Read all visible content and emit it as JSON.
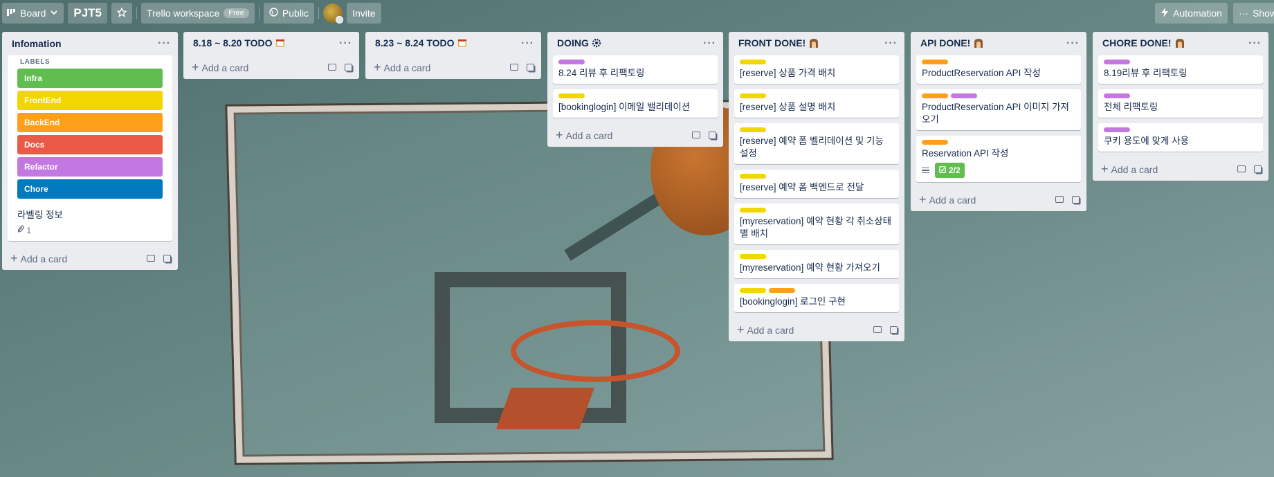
{
  "topbar": {
    "board_view": "Board",
    "board_title": "PJT5",
    "workspace": "Trello workspace",
    "workspace_badge": "Free",
    "visibility": "Public",
    "invite": "Invite",
    "automation": "Automation",
    "show_menu": "Show"
  },
  "lists": [
    {
      "title": "Infomation",
      "labels_heading": "LABELS",
      "labels": [
        {
          "name": "Infra",
          "color": "#61bd4f"
        },
        {
          "name": "FrontEnd",
          "color": "#f2d600"
        },
        {
          "name": "BackEnd",
          "color": "#ff9f1a"
        },
        {
          "name": "Docs",
          "color": "#eb5a46"
        },
        {
          "name": "Refactor",
          "color": "#c377e0"
        },
        {
          "name": "Chore",
          "color": "#0079bf"
        }
      ],
      "card_text": "라벨링 정보",
      "attachments": "1",
      "add_card": "Add a card"
    },
    {
      "title": "8.18 ~ 8.20 TODO",
      "add_card": "Add a card"
    },
    {
      "title": "8.23 ~ 8.24 TODO",
      "add_card": "Add a card"
    },
    {
      "title": "DOING",
      "cards": [
        {
          "text": "8.24 리뷰 후 리팩토링",
          "labels": [
            "purple"
          ]
        },
        {
          "text": "[bookinglogin] 이메일 밸리데이션",
          "labels": [
            "yellow"
          ]
        }
      ],
      "add_card": "Add a card"
    },
    {
      "title": "FRONT DONE!",
      "cards": [
        {
          "text": "[reserve] 상품 가격 배치",
          "labels": [
            "yellow"
          ]
        },
        {
          "text": "[reserve] 상품 설명 배치",
          "labels": [
            "yellow"
          ]
        },
        {
          "text": "[reserve] 예약 폼 벨리데이션 및 기능 설정",
          "labels": [
            "yellow"
          ]
        },
        {
          "text": "[reserve] 예약 폼 백엔드로 전달",
          "labels": [
            "yellow"
          ]
        },
        {
          "text": "[myreservation] 예약 현황 각 취소상태별 배치",
          "labels": [
            "yellow"
          ]
        },
        {
          "text": "[myreservation] 예약 현황 가져오기",
          "labels": [
            "yellow"
          ]
        },
        {
          "text": "[bookinglogin] 로그인 구현",
          "labels": [
            "yellow",
            "orange"
          ]
        }
      ],
      "add_card": "Add a card"
    },
    {
      "title": "API DONE!",
      "cards": [
        {
          "text": "ProductReservation API 작성",
          "labels": [
            "orange"
          ]
        },
        {
          "text": "ProductReservation API 이미지 가져오기",
          "labels": [
            "orange",
            "purple"
          ]
        },
        {
          "text": "Reservation API 작성",
          "labels": [
            "orange"
          ],
          "checklist": "2/2"
        }
      ],
      "add_card": "Add a card"
    },
    {
      "title": "CHORE DONE!",
      "cards": [
        {
          "text": "8.19리뷰 후 리팩토링",
          "labels": [
            "purple"
          ]
        },
        {
          "text": "전체 리팩토링",
          "labels": [
            "purple"
          ]
        },
        {
          "text": "쿠키 용도에 맞게 사용",
          "labels": [
            "purple"
          ]
        }
      ],
      "add_card": "Add a card"
    }
  ],
  "icons": {
    "board_view": "board-icon",
    "chevron": "chevron-down-icon",
    "star": "star-icon",
    "globe": "globe-icon",
    "lightning": "lightning-icon",
    "more": "more-icon",
    "calendar": "calendar-emoji-icon",
    "gear": "gear-icon",
    "ghost": "ghost-emoji-icon"
  }
}
